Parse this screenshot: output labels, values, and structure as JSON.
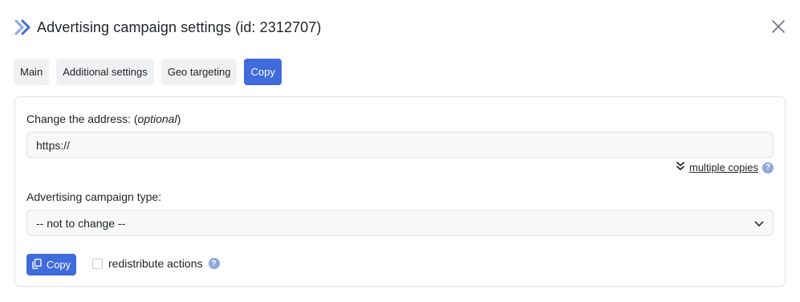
{
  "header": {
    "title": "Advertising campaign settings (id: 2312707)",
    "logo_icon": "double-chevron-right-icon",
    "close_icon": "close-icon"
  },
  "tabs": [
    {
      "label": "Main",
      "active": false
    },
    {
      "label": "Additional settings",
      "active": false
    },
    {
      "label": "Geo targeting",
      "active": false
    },
    {
      "label": "Copy",
      "active": true
    }
  ],
  "form": {
    "address_label": "Change the address: (",
    "address_label_optional": "optional",
    "address_label_end": ")",
    "address_value": "https://",
    "multiple_copies_label": "multiple copies",
    "campaign_type_label": "Advertising campaign type:",
    "campaign_type_value": "-- not to change --",
    "copy_button_label": "Copy",
    "redistribute_label": "redistribute actions",
    "redistribute_checked": false
  },
  "colors": {
    "accent": "#3f6bdc",
    "help_icon": "#8fa8de",
    "tab_bg": "#f0f1f3",
    "input_bg": "#f7f8f9"
  }
}
